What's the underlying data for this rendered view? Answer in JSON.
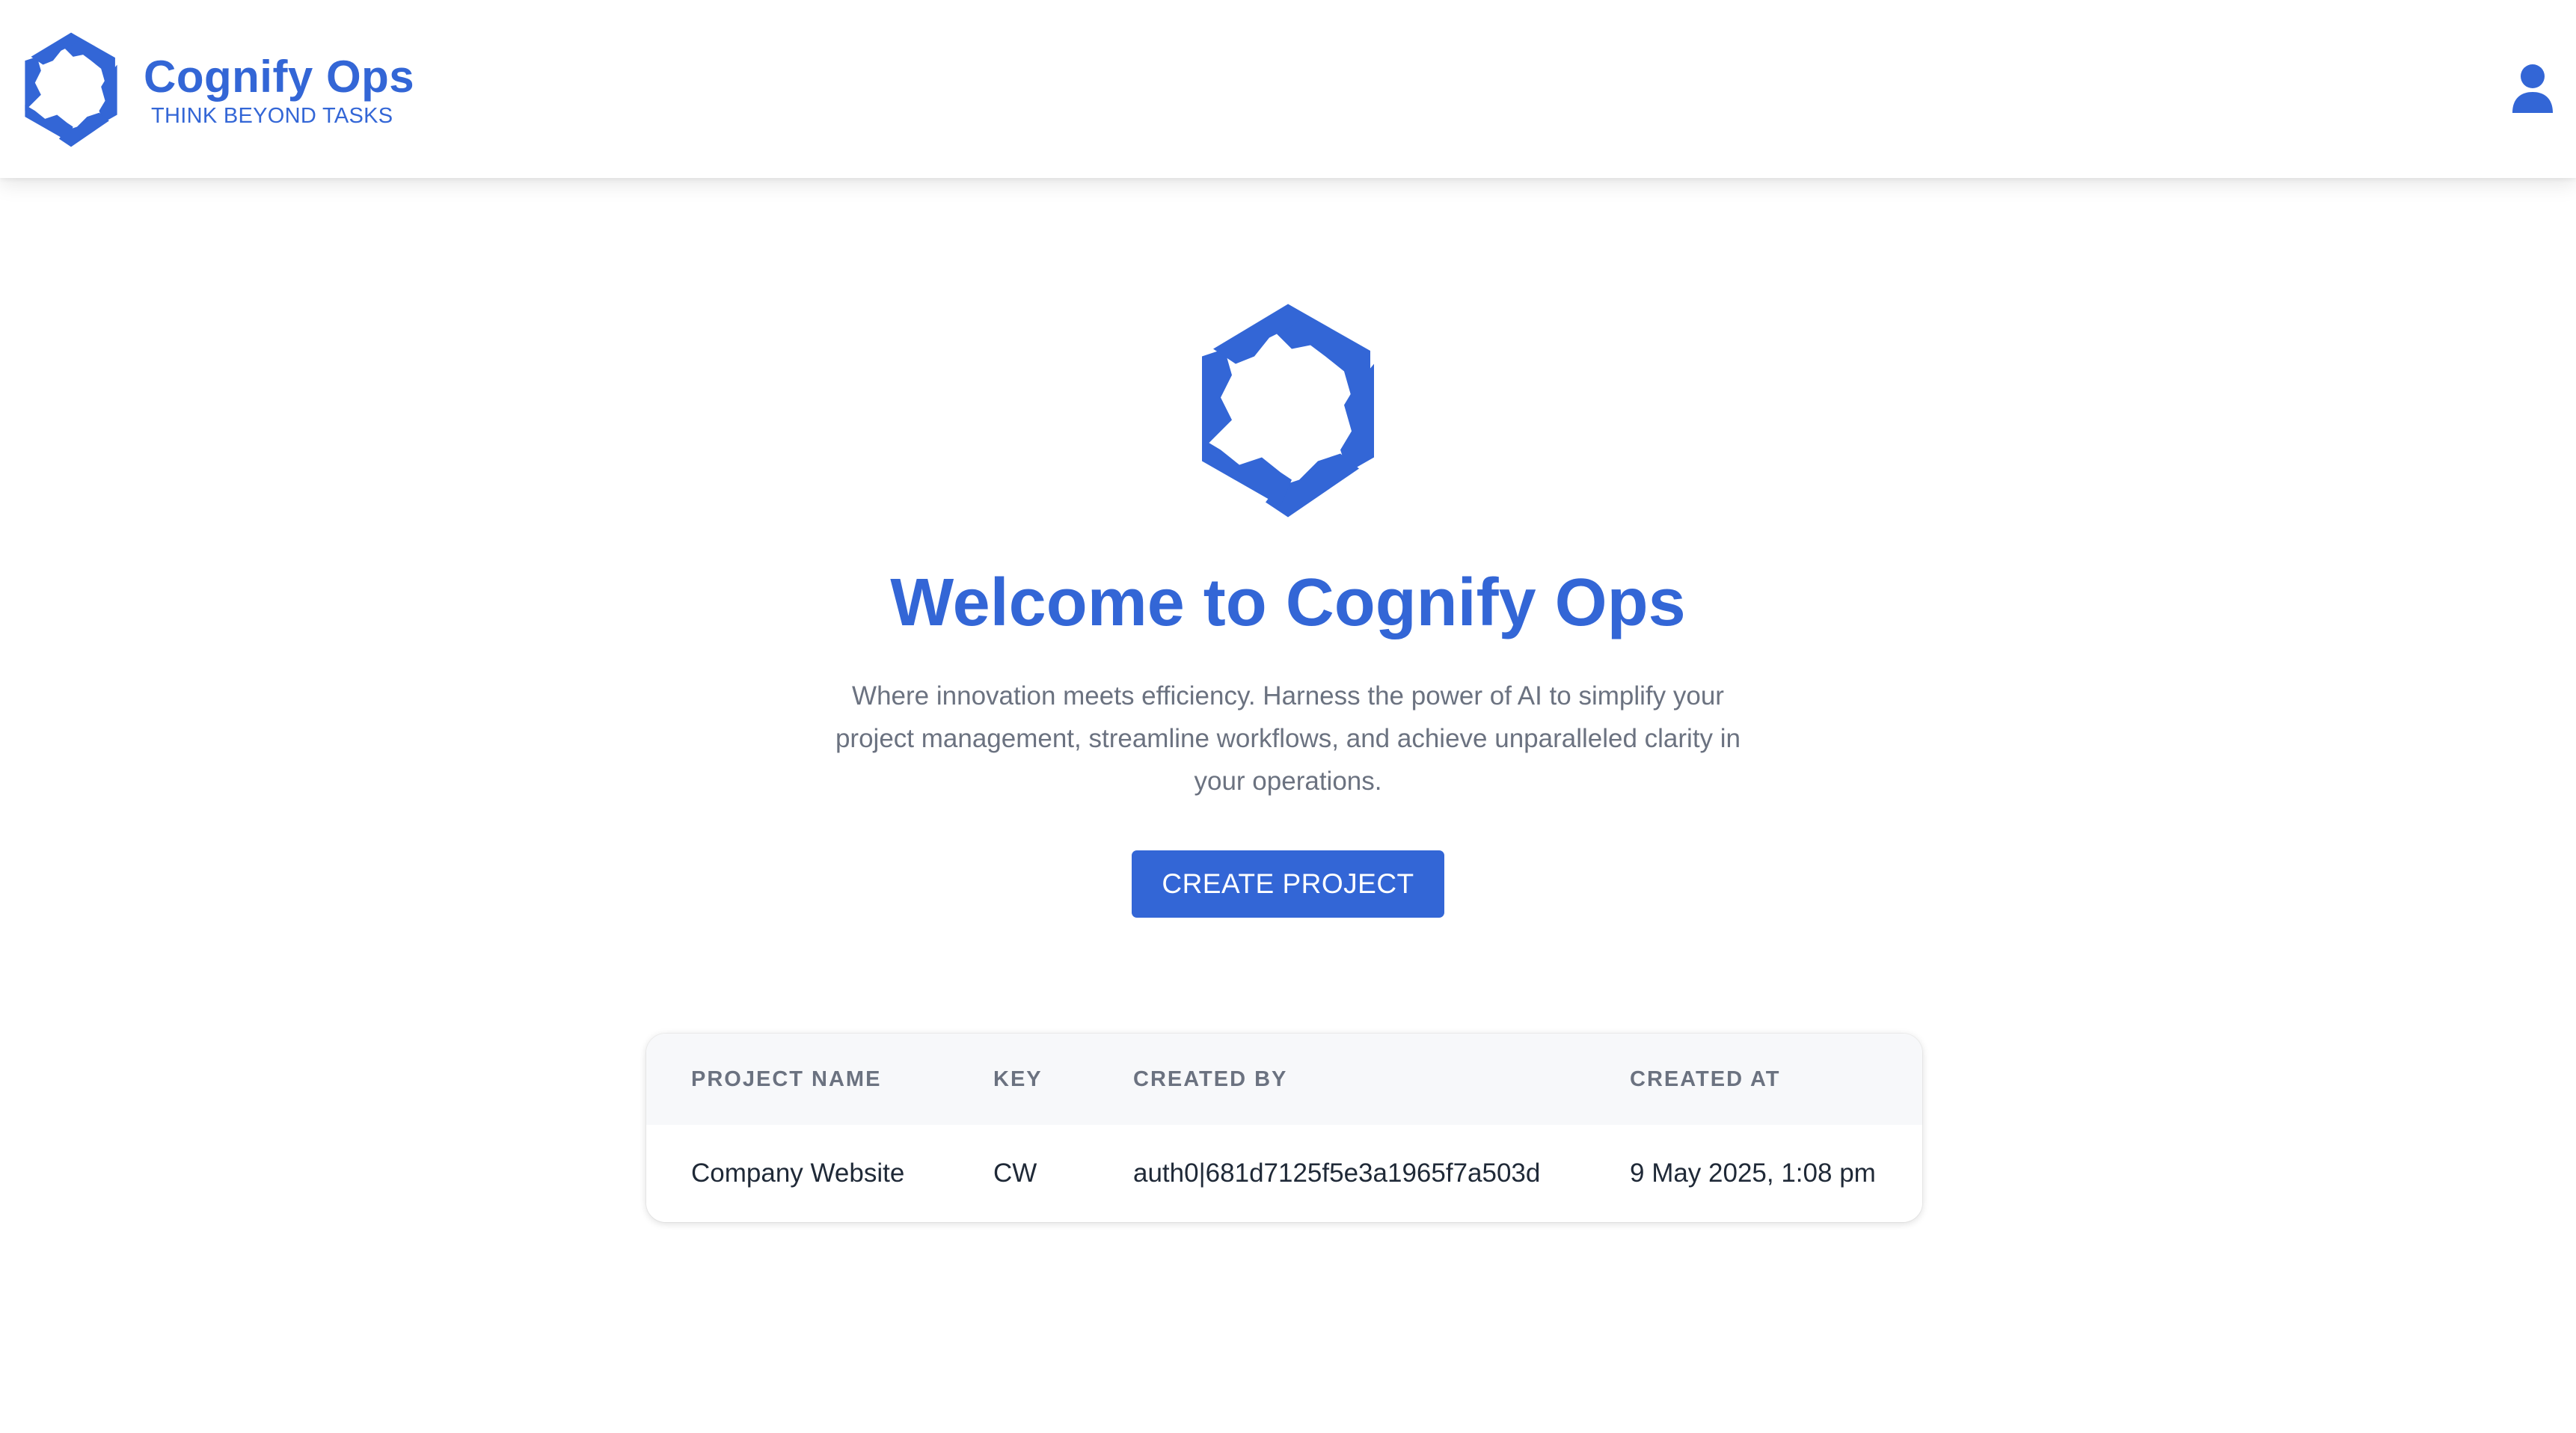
{
  "colors": {
    "brand": "#3366d6",
    "muted_text": "#6b7280",
    "body_text": "#1f2937",
    "table_header_bg": "#f7f8fa"
  },
  "header": {
    "logo_icon": "cognify-hexagon-logo-icon",
    "brand_name": "Cognify Ops",
    "tagline": "THINK BEYOND TASKS",
    "user_icon": "user-icon"
  },
  "hero": {
    "logo_icon": "cognify-hexagon-logo-icon",
    "title": "Welcome to Cognify Ops",
    "description": "Where innovation meets efficiency. Harness the power of AI to simplify your project management, streamline workflows, and achieve unparalleled clarity in your operations.",
    "create_button_label": "CREATE PROJECT"
  },
  "projects_table": {
    "columns": [
      "PROJECT NAME",
      "KEY",
      "CREATED BY",
      "CREATED AT"
    ],
    "rows": [
      [
        "Company Website",
        "CW",
        "auth0|681d7125f5e3a1965f7a503d",
        "9 May 2025, 1:08 pm"
      ]
    ]
  }
}
